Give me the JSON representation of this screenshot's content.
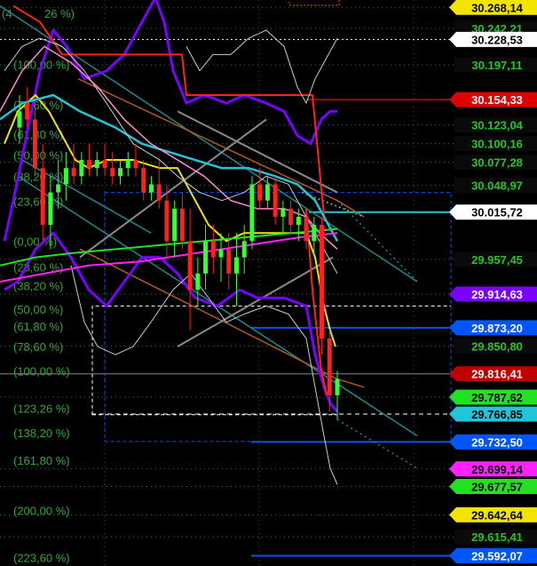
{
  "colors": {
    "background": "#000000",
    "grid_dotted": "#2f7a2f",
    "axis_label_bg_default": "#0a0a0a",
    "axis_label_text_default": "#27c427",
    "fib_text": "#2fa82f",
    "candle_up": "#33ff33",
    "candle_down": "#ff2020",
    "upper_band": "#7a00ff",
    "lower_band": "#ff2020",
    "white_band": "#cccccc",
    "cyan_ma": "#22c5d8",
    "pink_ma": "#ff8ad0",
    "yellow_ma": "#f2e400",
    "green_ma": "#22e022",
    "magenta_ma": "#ff22ff",
    "trend_teal": "#1b8a88",
    "trend_orange": "#b05a20",
    "trend_gray": "#8a8a8a",
    "horiz_blue": "#0055ff"
  },
  "chart_data": {
    "type": "candlestick",
    "y_unit": "price",
    "ylim": [
      29.585,
      30.275
    ],
    "price_levels": [
      {
        "value": 30.26814,
        "label": "30.268,14",
        "bg": "#f2e400",
        "text": "#000000"
      },
      {
        "value": 30.24221,
        "label": "30.242,21",
        "bg": "#0a0a0a",
        "text": "#27c427"
      },
      {
        "value": 30.22853,
        "label": "30.228,53",
        "bg": "#ffffff",
        "text": "#000000",
        "line": "dotted-white"
      },
      {
        "value": 30.19711,
        "label": "30.197,11",
        "bg": "#0a0a0a",
        "text": "#27c427"
      },
      {
        "value": 30.15433,
        "label": "30.154,33",
        "bg": "#e00000",
        "text": "#ffffff",
        "line": "red"
      },
      {
        "value": 30.12304,
        "label": "30.123,04",
        "bg": "#0a0a0a",
        "text": "#27c427"
      },
      {
        "value": 30.10016,
        "label": "30.100,16",
        "bg": "#0a0a0a",
        "text": "#27c427"
      },
      {
        "value": 30.07728,
        "label": "30.077,28",
        "bg": "#0a0a0a",
        "text": "#27c427"
      },
      {
        "value": 30.04897,
        "label": "30.048,97",
        "bg": "#0a0a0a",
        "text": "#27c427"
      },
      {
        "value": 30.01572,
        "label": "30.015,72",
        "bg": "#ffffff",
        "text": "#000000",
        "line": "cyan"
      },
      {
        "value": 29.95745,
        "label": "29.957,45",
        "bg": "#0a0a0a",
        "text": "#27c427"
      },
      {
        "value": 29.91463,
        "label": "29.914,63",
        "bg": "#7a00ff",
        "text": "#ffffff"
      },
      {
        "value": 29.8732,
        "label": "29.873,20",
        "bg": "#0055ff",
        "text": "#ffffff",
        "line": "blue"
      },
      {
        "value": 29.8508,
        "label": "29.850,80",
        "bg": "#0a0a0a",
        "text": "#27c427"
      },
      {
        "value": 29.81641,
        "label": "29.816,41",
        "bg": "#c00000",
        "text": "#ffffff",
        "line": "gray"
      },
      {
        "value": 29.78762,
        "label": "29.787,62",
        "bg": "#22e022",
        "text": "#000000"
      },
      {
        "value": 29.76685,
        "label": "29.766,85",
        "bg": "#22c5d8",
        "text": "#000000",
        "line": "dashed-white"
      },
      {
        "value": 29.7325,
        "label": "29.732,50",
        "bg": "#0055ff",
        "text": "#ffffff",
        "line": "blue"
      },
      {
        "value": 29.69914,
        "label": "29.699,14",
        "bg": "#ff22ff",
        "text": "#000000"
      },
      {
        "value": 29.67757,
        "label": "29.677,57",
        "bg": "#22e022",
        "text": "#000000"
      },
      {
        "value": 29.64264,
        "label": "29.642,64",
        "bg": "#f2e400",
        "text": "#000000"
      },
      {
        "value": 29.61541,
        "label": "29.615,41",
        "bg": "#0a0a0a",
        "text": "#27c427"
      },
      {
        "value": 29.59207,
        "label": "29.592,07",
        "bg": "#0055ff",
        "text": "#ffffff",
        "line": "blue"
      }
    ],
    "fib_labels": [
      {
        "label": "(100,00 %)",
        "value": 30.198
      },
      {
        "label": "(78,60 %)",
        "value": 30.148
      },
      {
        "label": "(61,80 %)",
        "value": 30.112
      },
      {
        "label": "(50,00 %)",
        "value": 30.086
      },
      {
        "label": "(38,20 %)",
        "value": 30.06
      },
      {
        "label": "(23,60 %)",
        "value": 30.029
      },
      {
        "label": "(0,00 %)",
        "value": 29.98
      },
      {
        "label": "(23,60 %)",
        "value": 29.948
      },
      {
        "label": "(38,20 %)",
        "value": 29.925
      },
      {
        "label": "(50,00 %)",
        "value": 29.896
      },
      {
        "label": "(61,80 %)",
        "value": 29.875
      },
      {
        "label": "(78,60 %)",
        "value": 29.85
      },
      {
        "label": "(100,00 %)",
        "value": 29.82
      },
      {
        "label": "(123,26 %)",
        "value": 29.774
      },
      {
        "label": "(138,20 %)",
        "value": 29.744
      },
      {
        "label": "(161,80 %)",
        "value": 29.71
      },
      {
        "label": "(200,00 %)",
        "value": 29.648
      },
      {
        "label": "(223,60 %)",
        "value": 29.59
      }
    ],
    "fib_top_partial": "(4",
    "fib_top_partial2": "26 %)",
    "candles": [
      {
        "o": 30.12,
        "h": 30.16,
        "l": 30.1,
        "c": 30.14
      },
      {
        "o": 30.15,
        "h": 30.17,
        "l": 30.12,
        "c": 30.13
      },
      {
        "o": 30.13,
        "h": 30.15,
        "l": 30.06,
        "c": 30.07
      },
      {
        "o": 30.07,
        "h": 30.1,
        "l": 29.98,
        "c": 30.0
      },
      {
        "o": 30.0,
        "h": 30.06,
        "l": 29.97,
        "c": 30.04
      },
      {
        "o": 30.04,
        "h": 30.08,
        "l": 30.02,
        "c": 30.05
      },
      {
        "o": 30.05,
        "h": 30.09,
        "l": 30.03,
        "c": 30.07
      },
      {
        "o": 30.07,
        "h": 30.1,
        "l": 30.05,
        "c": 30.06
      },
      {
        "o": 30.06,
        "h": 30.09,
        "l": 30.05,
        "c": 30.08
      },
      {
        "o": 30.08,
        "h": 30.1,
        "l": 30.06,
        "c": 30.07
      },
      {
        "o": 30.07,
        "h": 30.09,
        "l": 30.06,
        "c": 30.08
      },
      {
        "o": 30.08,
        "h": 30.1,
        "l": 30.06,
        "c": 30.07
      },
      {
        "o": 30.07,
        "h": 30.09,
        "l": 30.05,
        "c": 30.06
      },
      {
        "o": 30.06,
        "h": 30.08,
        "l": 30.05,
        "c": 30.07
      },
      {
        "o": 30.07,
        "h": 30.09,
        "l": 30.06,
        "c": 30.08
      },
      {
        "o": 30.08,
        "h": 30.1,
        "l": 30.06,
        "c": 30.07
      },
      {
        "o": 30.07,
        "h": 30.08,
        "l": 30.03,
        "c": 30.04
      },
      {
        "o": 30.04,
        "h": 30.06,
        "l": 30.03,
        "c": 30.05
      },
      {
        "o": 30.05,
        "h": 30.08,
        "l": 30.02,
        "c": 30.03
      },
      {
        "o": 30.03,
        "h": 30.05,
        "l": 29.96,
        "c": 29.98
      },
      {
        "o": 29.98,
        "h": 30.03,
        "l": 29.96,
        "c": 30.02
      },
      {
        "o": 30.02,
        "h": 30.04,
        "l": 29.97,
        "c": 29.98
      },
      {
        "o": 29.98,
        "h": 30.02,
        "l": 29.87,
        "c": 29.92
      },
      {
        "o": 29.92,
        "h": 29.96,
        "l": 29.9,
        "c": 29.94
      },
      {
        "o": 29.94,
        "h": 30.0,
        "l": 29.92,
        "c": 29.98
      },
      {
        "o": 29.98,
        "h": 30.0,
        "l": 29.94,
        "c": 29.96
      },
      {
        "o": 29.96,
        "h": 29.99,
        "l": 29.93,
        "c": 29.97
      },
      {
        "o": 29.97,
        "h": 29.99,
        "l": 29.92,
        "c": 29.94
      },
      {
        "o": 29.94,
        "h": 29.99,
        "l": 29.9,
        "c": 29.96
      },
      {
        "o": 29.96,
        "h": 30.0,
        "l": 29.94,
        "c": 29.98
      },
      {
        "o": 29.98,
        "h": 30.06,
        "l": 29.97,
        "c": 30.05
      },
      {
        "o": 30.05,
        "h": 30.07,
        "l": 30.02,
        "c": 30.03
      },
      {
        "o": 30.03,
        "h": 30.06,
        "l": 30.02,
        "c": 30.05
      },
      {
        "o": 30.05,
        "h": 30.06,
        "l": 30.0,
        "c": 30.01
      },
      {
        "o": 30.01,
        "h": 30.03,
        "l": 29.99,
        "c": 30.02
      },
      {
        "o": 30.02,
        "h": 30.03,
        "l": 29.99,
        "c": 30.0
      },
      {
        "o": 30.0,
        "h": 30.02,
        "l": 29.98,
        "c": 30.01
      },
      {
        "o": 30.01,
        "h": 30.02,
        "l": 29.97,
        "c": 29.98
      },
      {
        "o": 29.98,
        "h": 30.01,
        "l": 29.96,
        "c": 30.0
      },
      {
        "o": 30.0,
        "h": 30.01,
        "l": 29.84,
        "c": 29.86
      },
      {
        "o": 29.86,
        "h": 29.87,
        "l": 29.77,
        "c": 29.79
      },
      {
        "o": 29.79,
        "h": 29.82,
        "l": 29.76,
        "c": 29.81
      }
    ]
  }
}
